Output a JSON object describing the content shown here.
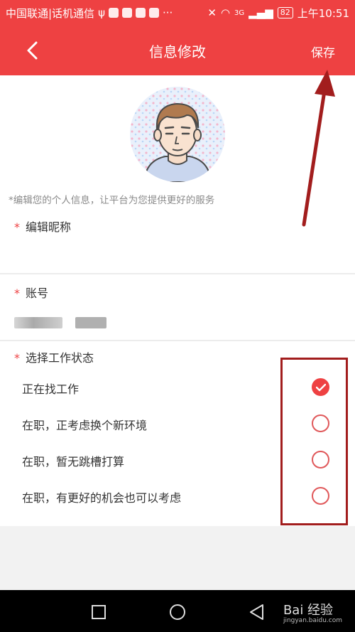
{
  "status_bar": {
    "carrier": "中国联通|话机通信",
    "dots": "···",
    "signal": "3G",
    "battery": "82",
    "time": "上午10:51"
  },
  "nav": {
    "title": "信息修改",
    "save_label": "保存",
    "back_icon": "chevron-left-icon"
  },
  "profile": {
    "hint": "*编辑您的个人信息，让平台为您提供更好的服务"
  },
  "fields": {
    "nickname_label": "编辑昵称",
    "account_label": "账号",
    "status_label": "选择工作状态",
    "required_mark": "*"
  },
  "work_status": {
    "options": [
      {
        "label": "正在找工作",
        "checked": true
      },
      {
        "label": "在职，正考虑换个新环境",
        "checked": false
      },
      {
        "label": "在职，暂无跳槽打算",
        "checked": false
      },
      {
        "label": "在职，有更好的机会也可以考虑",
        "checked": false
      }
    ]
  },
  "watermark": {
    "brand": "Bai 经验",
    "url": "jingyan.baidu.com"
  },
  "colors": {
    "accent": "#ee4142",
    "annotation": "#a21d1d"
  }
}
